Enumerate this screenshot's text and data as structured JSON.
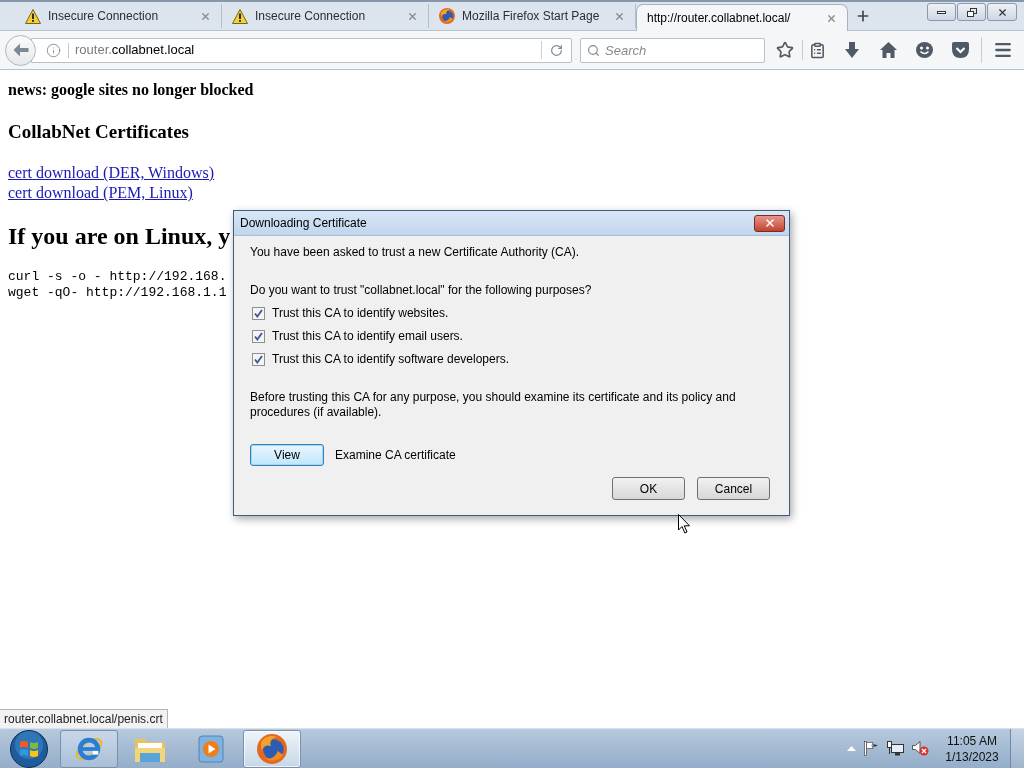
{
  "browser": {
    "tabs": [
      {
        "title": "Insecure Connection",
        "kind": "warning",
        "selected": false
      },
      {
        "title": "Insecure Connection",
        "kind": "warning",
        "selected": false
      },
      {
        "title": "Mozilla Firefox Start Page",
        "kind": "browser",
        "selected": false
      },
      {
        "title": "http://router.collabnet.local/",
        "kind": "plain",
        "selected": true
      }
    ],
    "address_bar": {
      "url_prefix": "router.",
      "url_host": "collabnet.local"
    },
    "search": {
      "placeholder": "Search"
    }
  },
  "page": {
    "news": "news: google sites no longer blocked",
    "heading": "CollabNet Certificates",
    "links": [
      "cert download (DER, Windows)",
      "cert download (PEM, Linux)"
    ],
    "linux_heading": "If you are on Linux, y",
    "code_lines": [
      "curl -s -o - http://192.168.",
      "wget -qO- http://192.168.1.1"
    ]
  },
  "dialog": {
    "title": "Downloading Certificate",
    "intro": "You have been asked to trust a new Certificate Authority (CA).",
    "question": "Do you want to trust \"collabnet.local\" for the following purposes?",
    "purposes": [
      {
        "label": "Trust this CA to identify websites.",
        "checked": true
      },
      {
        "label": "Trust this CA to identify email users.",
        "checked": true
      },
      {
        "label": "Trust this CA to identify software developers.",
        "checked": true
      }
    ],
    "advice": "Before trusting this CA for any purpose, you should examine its certificate and its policy and procedures (if available).",
    "view_button": {
      "label": "View",
      "focused": true
    },
    "view_caption": "Examine CA certificate",
    "buttons": [
      {
        "label": "OK",
        "focused": false
      },
      {
        "label": "Cancel",
        "focused": false
      }
    ]
  },
  "status_url": "router.collabnet.local/penis.crt",
  "taskbar": {
    "apps": [
      {
        "kind": "ie",
        "running": true,
        "selected": false
      },
      {
        "kind": "explorer",
        "running": false,
        "selected": false
      },
      {
        "kind": "media_player",
        "running": false,
        "selected": false
      },
      {
        "kind": "firefox",
        "running": true,
        "selected": true
      }
    ],
    "clock": {
      "time": "11:05 AM",
      "date": "1/13/2023"
    }
  }
}
